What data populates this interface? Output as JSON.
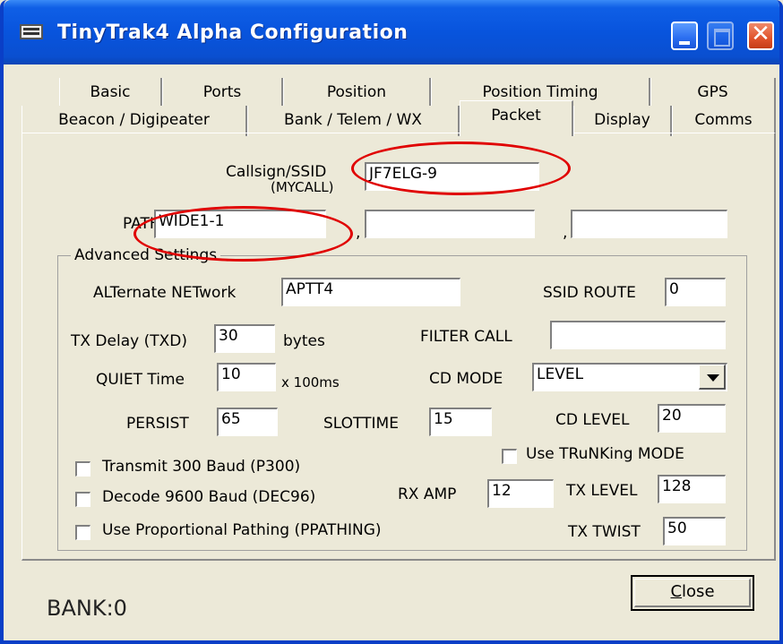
{
  "window": {
    "title": "TinyTrak4 Alpha Configuration"
  },
  "tabs_row1": [
    "Basic",
    "Ports",
    "Position",
    "Position Timing",
    "GPS"
  ],
  "tabs_row2": [
    "Beacon / Digipeater",
    "Bank / Telem / WX",
    "Packet",
    "Display",
    "Comms"
  ],
  "active_tab": "Packet",
  "callsign": {
    "label_line1": "Callsign/SSID",
    "label_line2": "(MYCALL)",
    "value": "JF7ELG-9"
  },
  "path": {
    "label": "PATH",
    "value1": "WIDE1-1",
    "value2": "",
    "value3": "",
    "sep": ","
  },
  "advanced": {
    "legend": "Advanced Settings",
    "alternate_net": {
      "label": "ALTernate NETwork",
      "value": "APTT4"
    },
    "ssid_route": {
      "label": "SSID ROUTE",
      "value": "0"
    },
    "tx_delay": {
      "label": "TX Delay (TXD)",
      "value": "30",
      "unit": "bytes"
    },
    "filter_call": {
      "label": "FILTER CALL",
      "value": ""
    },
    "quiet_time": {
      "label": "QUIET Time",
      "value": "10",
      "unit": "x 100ms"
    },
    "cd_mode": {
      "label": "CD MODE",
      "value": "LEVEL"
    },
    "persist": {
      "label": "PERSIST",
      "value": "65"
    },
    "slottime": {
      "label": "SLOTTIME",
      "value": "15"
    },
    "cd_level": {
      "label": "CD LEVEL",
      "value": "20"
    },
    "use_trunking": {
      "label": "Use TRuNKing MODE",
      "checked": false
    },
    "transmit_300": {
      "label": "Transmit 300 Baud (P300)",
      "checked": false
    },
    "decode_9600": {
      "label": "Decode 9600 Baud (DEC96)",
      "checked": false
    },
    "use_ppathing": {
      "label": "Use Proportional Pathing (PPATHING)",
      "checked": false
    },
    "rx_amp": {
      "label": "RX AMP",
      "value": "12"
    },
    "tx_level": {
      "label": "TX LEVEL",
      "value": "128"
    },
    "tx_twist": {
      "label": "TX TWIST",
      "value": "50"
    }
  },
  "status": {
    "bank": "BANK:0"
  },
  "buttons": {
    "close_accel": "C",
    "close_rest": "lose"
  },
  "colors": {
    "titlebar": "#0854dd",
    "annotation": "#e00000",
    "face": "#ece9d8"
  }
}
